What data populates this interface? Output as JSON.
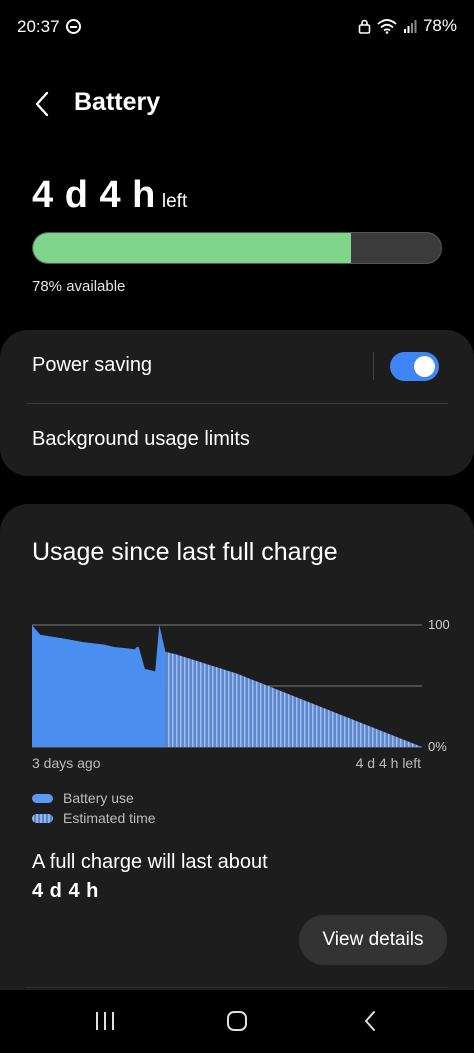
{
  "status_bar": {
    "time": "20:37",
    "battery_percent": "78%"
  },
  "header": {
    "title": "Battery"
  },
  "summary": {
    "time_left": "4 d 4 h",
    "time_left_suffix": "left",
    "level_fraction": 0.78,
    "available_text": "78% available",
    "level_color": "#7fd58c"
  },
  "settings": {
    "power_saving_label": "Power saving",
    "power_saving_on": true,
    "background_limits_label": "Background usage limits"
  },
  "usage": {
    "title": "Usage since last full charge",
    "x_start_label": "3 days ago",
    "x_end_label": "4 d 4 h left",
    "legend": [
      {
        "label": "Battery use",
        "icon": "solid-swatch"
      },
      {
        "label": "Estimated time",
        "icon": "striped-swatch"
      }
    ],
    "full_charge_label": "A full charge will last about",
    "full_charge_value": "4 d 4 h",
    "view_details_label": "View details"
  },
  "chart_data": {
    "type": "area",
    "y_tick_labels": [
      "100",
      "0%"
    ],
    "ylim": [
      0,
      100
    ],
    "grid": true,
    "series": [
      {
        "name": "Battery use",
        "x": [
          0,
          0.02,
          0.04,
          0.15,
          0.25,
          0.35,
          0.4,
          0.46,
          0.5,
          0.51,
          0.52,
          0.55,
          0.6,
          0.62,
          0.65
        ],
        "values": [
          100,
          96,
          92,
          89,
          86,
          84,
          82,
          81,
          80,
          82,
          82,
          64,
          62,
          100,
          78
        ],
        "color": "#4a8ef0"
      },
      {
        "name": "Estimated time",
        "x": [
          0.65,
          0.7,
          1.0,
          1.6,
          1.9
        ],
        "values": [
          78,
          76,
          60,
          20,
          0
        ],
        "color": "#7fa3e6"
      }
    ]
  },
  "nav": {
    "recents_icon": "recents-icon",
    "home_icon": "home-icon",
    "back_icon": "back-icon"
  }
}
